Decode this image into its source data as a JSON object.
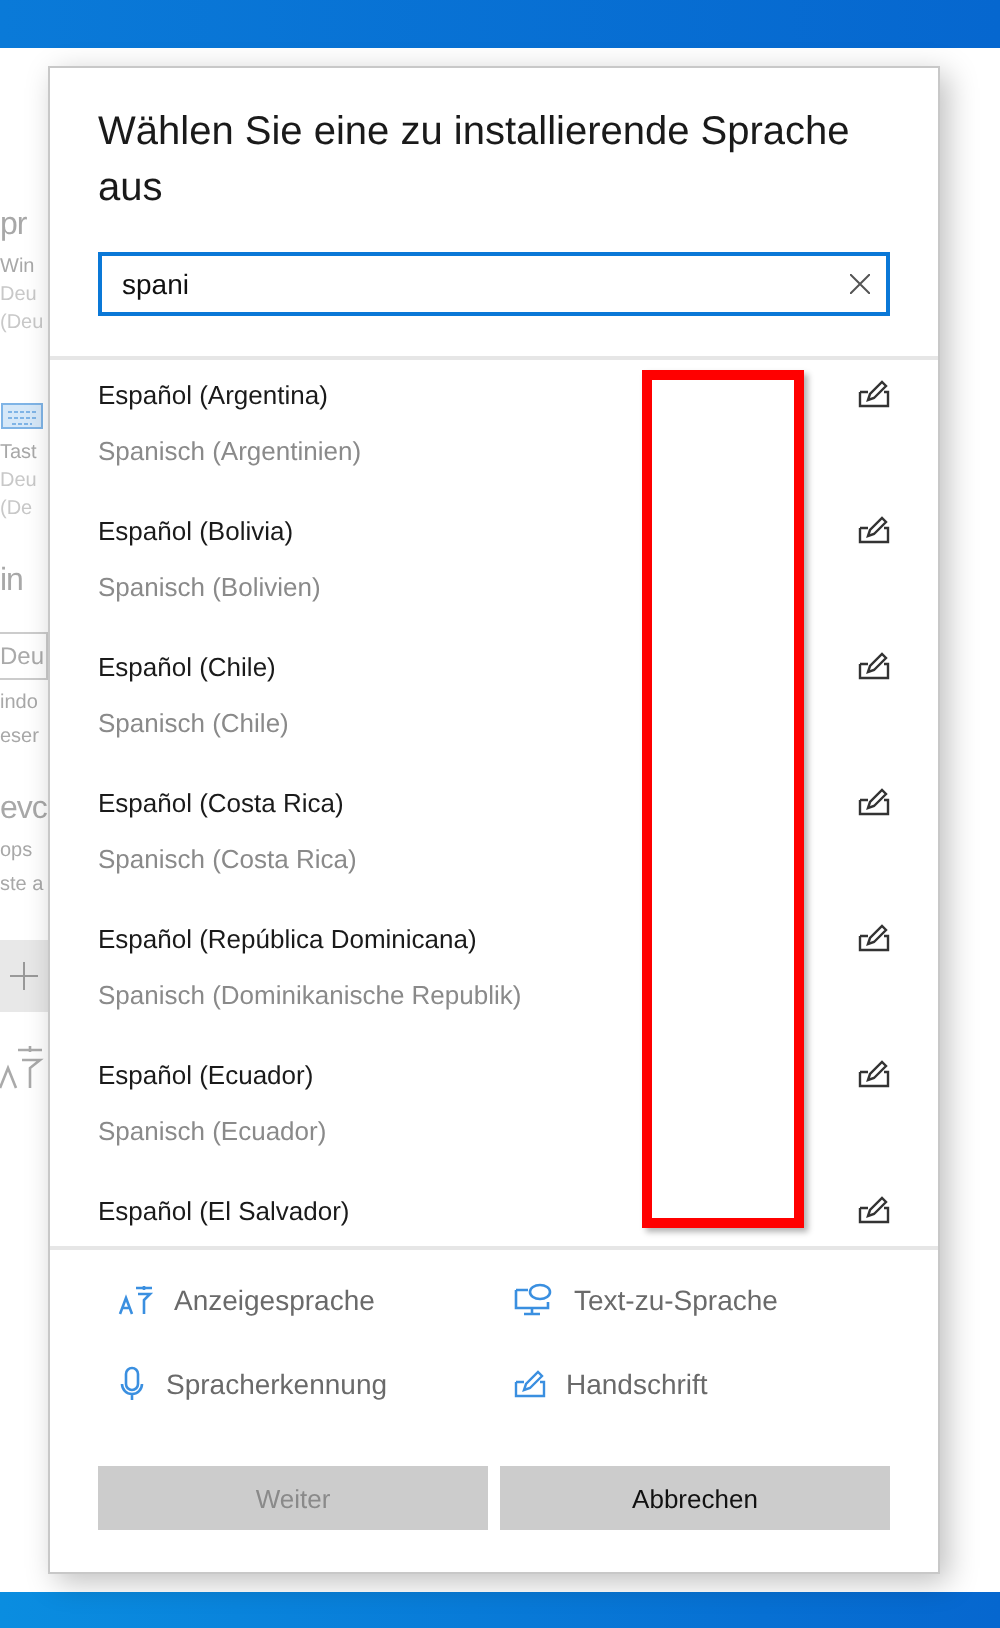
{
  "background_window": {
    "texts": [
      {
        "kind": "heading",
        "text": "pr"
      },
      {
        "kind": "label",
        "text": "Win"
      },
      {
        "kind": "sub",
        "text": "Deu"
      },
      {
        "kind": "sub",
        "text": "(Deu"
      },
      {
        "kind": "keyboard"
      },
      {
        "kind": "label",
        "text": "Tast"
      },
      {
        "kind": "sub",
        "text": "Deu"
      },
      {
        "kind": "sub",
        "text": "(De"
      },
      {
        "kind": "heading",
        "text": "in"
      },
      {
        "kind": "field",
        "text": "Deu"
      },
      {
        "kind": "label",
        "text": "indo"
      },
      {
        "kind": "label",
        "text": "eser"
      },
      {
        "kind": "heading",
        "text": "evc"
      },
      {
        "kind": "label",
        "text": "ops"
      },
      {
        "kind": "label",
        "text": "ste a"
      },
      {
        "kind": "plus"
      },
      {
        "kind": "language"
      }
    ]
  },
  "dialog": {
    "title": "Wählen Sie eine zu installierende Sprache aus",
    "search": {
      "value": "spani"
    },
    "languages": [
      {
        "name": "Español (Argentina)",
        "translation": "Spanisch (Argentinien)"
      },
      {
        "name": "Español (Bolivia)",
        "translation": "Spanisch (Bolivien)"
      },
      {
        "name": "Español (Chile)",
        "translation": "Spanisch (Chile)"
      },
      {
        "name": "Español (Costa Rica)",
        "translation": "Spanisch (Costa Rica)"
      },
      {
        "name": "Español (República Dominicana)",
        "translation": "Spanisch (Dominikanische Republik)"
      },
      {
        "name": "Español (Ecuador)",
        "translation": "Spanisch (Ecuador)"
      },
      {
        "name": "Español (El Salvador)"
      }
    ],
    "features": [
      {
        "kind": "display",
        "label": "Anzeigesprache"
      },
      {
        "kind": "speech",
        "label": "Text-zu-Sprache"
      },
      {
        "kind": "mic",
        "label": "Spracherkennung"
      },
      {
        "kind": "handwriting",
        "label": "Handschrift"
      }
    ],
    "buttons": [
      {
        "label": "Weiter",
        "disabled": true
      },
      {
        "label": "Abbrechen",
        "disabled": false
      }
    ]
  }
}
